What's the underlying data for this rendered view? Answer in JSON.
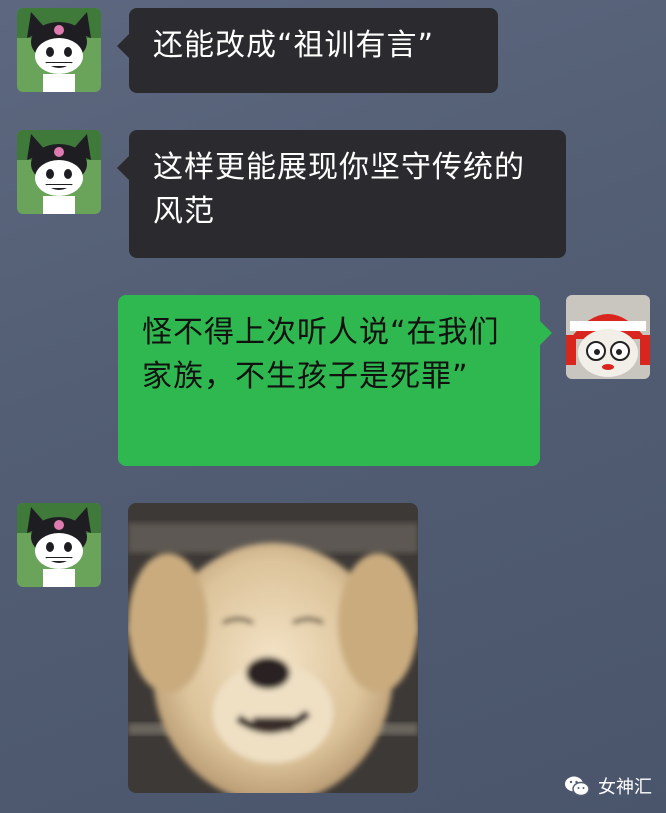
{
  "messages": [
    {
      "side": "left",
      "sender_icon": "kuromi-avatar-icon",
      "text": "还能改成“祖训有言”"
    },
    {
      "side": "left",
      "sender_icon": "kuromi-avatar-icon",
      "text": "这样更能展现你坚守传统的风范"
    },
    {
      "side": "right",
      "sender_icon": "red-hat-character-avatar-icon",
      "text": "怪不得上次听人说“在我们家族，不生孩子是死罪”"
    },
    {
      "side": "left",
      "sender_icon": "kuromi-avatar-icon",
      "image": "blurry-golden-puppy-photo"
    }
  ],
  "watermark": {
    "text": "女神汇",
    "icon": "wechat-icon"
  },
  "colors": {
    "left_bubble": "#2b2b2f",
    "right_bubble": "#2eb84f",
    "background": "#535e74"
  }
}
